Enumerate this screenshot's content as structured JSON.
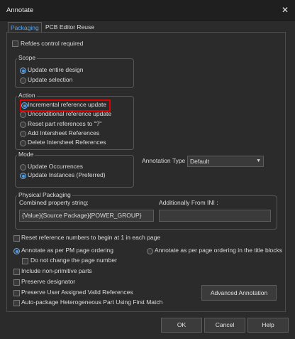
{
  "window": {
    "title": "Annotate",
    "close_glyph": "✕"
  },
  "tabs": [
    {
      "label": "Packaging",
      "active": true
    },
    {
      "label": "PCB Editor Reuse",
      "active": false
    }
  ],
  "refdes_control": {
    "label": "Refdes control required",
    "checked": false
  },
  "scope": {
    "title": "Scope",
    "options": [
      {
        "label": "Update entire design",
        "selected": true
      },
      {
        "label": "Update selection",
        "selected": false
      }
    ]
  },
  "action": {
    "title": "Action",
    "options": [
      {
        "label": "Incremental reference update",
        "selected": true
      },
      {
        "label": "Unconditional reference update",
        "selected": false
      },
      {
        "label": "Reset part references to \"?\"",
        "selected": false
      },
      {
        "label": "Add Intersheet References",
        "selected": false
      },
      {
        "label": "Delete Intersheet References",
        "selected": false
      }
    ]
  },
  "mode": {
    "title": "Mode",
    "options": [
      {
        "label": "Update Occurrences",
        "selected": false
      },
      {
        "label": "Update Instances (Preferred)",
        "selected": true
      }
    ]
  },
  "annotation_type": {
    "label": "Annotation Type",
    "value": "Default",
    "arrow_glyph": "▼"
  },
  "physical_packaging": {
    "title": "Physical Packaging",
    "combined_label": "Combined property string:",
    "combined_value": "{Value}{Source Package}{POWER_GROUP}",
    "additionally_label": "Additionally From INI :",
    "additionally_value": ""
  },
  "reset_refs": {
    "label": "Reset reference numbers to begin at 1 in each page",
    "checked": false
  },
  "ordering": {
    "pm_label": "Annotate as per PM page ordering",
    "pm_selected": true,
    "title_blocks_label": "Annotate as per page ordering in the title blocks",
    "title_blocks_selected": false
  },
  "checkboxes": [
    {
      "label": "Do not change the page number",
      "checked": false
    },
    {
      "label": "Include non-primitive parts",
      "checked": false
    },
    {
      "label": "Preserve designator",
      "checked": false
    },
    {
      "label": "Preserve User Assigned Valid References",
      "checked": false
    },
    {
      "label": "Auto-package Heterogeneous Part Using First Match",
      "checked": false
    }
  ],
  "buttons": {
    "advanced": "Advanced Annotation",
    "ok": "OK",
    "cancel": "Cancel",
    "help": "Help"
  },
  "colors": {
    "background": "#2b2b2b",
    "accent": "#5aa3e8",
    "highlight_border": "#e00000"
  }
}
